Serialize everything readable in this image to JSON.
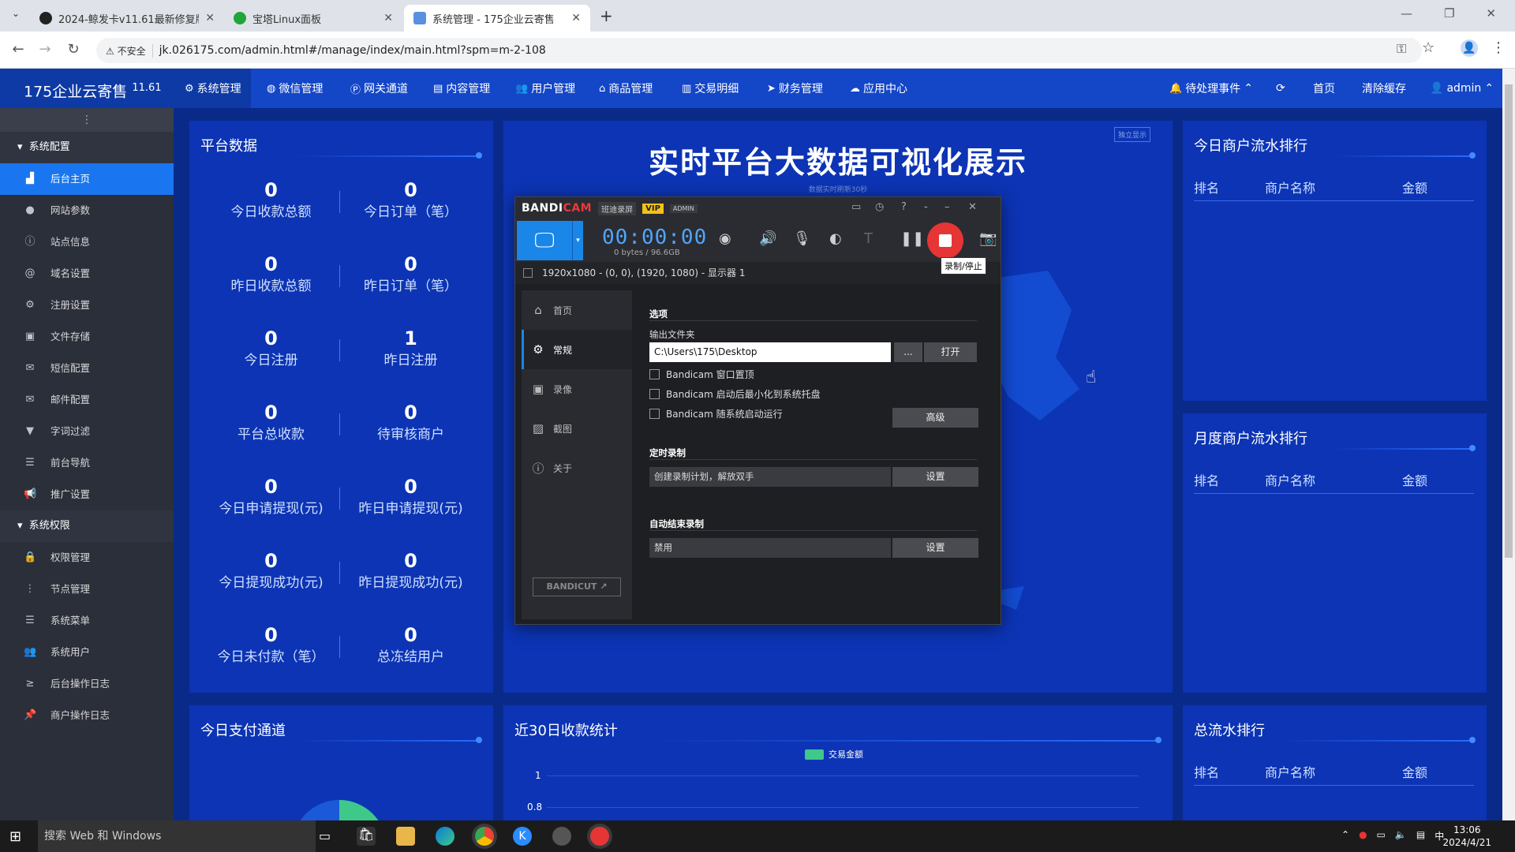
{
  "browser": {
    "tabs": [
      {
        "title": "2024-鲸发卡v11.61最新修复版"
      },
      {
        "title": "宝塔Linux面板"
      },
      {
        "title": "系统管理 - 175企业云寄售"
      }
    ],
    "insecure_label": "不安全",
    "url": "jk.026175.com/admin.html#/manage/index/main.html?spm=m-2-108"
  },
  "header": {
    "logo": "175企业云寄售",
    "version": "11.61",
    "nav": [
      "系统管理",
      "微信管理",
      "网关通道",
      "内容管理",
      "用户管理",
      "商品管理",
      "交易明细",
      "财务管理",
      "应用中心"
    ],
    "right": {
      "pending": "待处理事件",
      "home": "首页",
      "clear_cache": "清除缓存",
      "user": "admin"
    }
  },
  "sidebar": {
    "group1": "系统配置",
    "items1": [
      "后台主页",
      "网站参数",
      "站点信息",
      "域名设置",
      "注册设置",
      "文件存储",
      "短信配置",
      "邮件配置",
      "字词过滤",
      "前台导航",
      "推广设置"
    ],
    "group2": "系统权限",
    "items2": [
      "权限管理",
      "节点管理",
      "系统菜单",
      "系统用户",
      "后台操作日志",
      "商户操作日志"
    ]
  },
  "platform": {
    "title": "平台数据",
    "stats": [
      {
        "value": "0",
        "label": "今日收款总额"
      },
      {
        "value": "0",
        "label": "今日订单（笔）"
      },
      {
        "value": "0",
        "label": "昨日收款总额"
      },
      {
        "value": "0",
        "label": "昨日订单（笔）"
      },
      {
        "value": "0",
        "label": "今日注册"
      },
      {
        "value": "1",
        "label": "昨日注册"
      },
      {
        "value": "0",
        "label": "平台总收款"
      },
      {
        "value": "0",
        "label": "待审核商户"
      },
      {
        "value": "0",
        "label": "今日申请提现(元)"
      },
      {
        "value": "0",
        "label": "昨日申请提现(元)"
      },
      {
        "value": "0",
        "label": "今日提现成功(元)"
      },
      {
        "value": "0",
        "label": "昨日提现成功(元)"
      },
      {
        "value": "0",
        "label": "今日未付款（笔）"
      },
      {
        "value": "0",
        "label": "总冻结用户"
      }
    ]
  },
  "center": {
    "title": "实时平台大数据可视化展示",
    "subtitle": "数据实时刷新30秒",
    "indep": "独立显示"
  },
  "ranks": {
    "today": "今日商户流水排行",
    "month": "月度商户流水排行",
    "total": "总流水排行",
    "cols": [
      "排名",
      "商户名称",
      "金额"
    ]
  },
  "bottom": {
    "pay_channel": "今日支付通道",
    "stats30": "近30日收款统计"
  },
  "chart_data": {
    "type": "line",
    "title": "近30日收款统计",
    "legend": [
      "交易金额"
    ],
    "y_ticks": [
      "1",
      "0.8"
    ],
    "legend_color": "#3ec88a"
  },
  "bandicam": {
    "logo_a": "BANDI",
    "logo_b": "CAM",
    "tag": "班迪录屏",
    "vip": "VIP",
    "admin": "ADMIN",
    "timer": "00:00:00",
    "bytes": "0 bytes / 96.6GB",
    "tooltip": "录制/停止",
    "area": "1920x1080 - (0, 0), (1920, 1080) - 显示器 1",
    "menu": [
      "首页",
      "常规",
      "录像",
      "截图",
      "关于"
    ],
    "bandicut": "BANDICUT",
    "options": "选项",
    "output_folder": "输出文件夹",
    "folder_path": "C:\\Users\\175\\Desktop",
    "browse": "...",
    "open": "打开",
    "checks": [
      "Bandicam 窗口置顶",
      "Bandicam 启动后最小化到系统托盘",
      "Bandicam 随系统启动运行"
    ],
    "advanced": "高级",
    "timer_rec": "定时录制",
    "timer_field": "创建录制计划，解放双手",
    "set": "设置",
    "auto_stop": "自动结束录制",
    "disabled": "禁用"
  },
  "taskbar": {
    "search": "搜索 Web 和 Windows",
    "time": "13:06",
    "date": "2024/4/21",
    "ime": "中"
  }
}
